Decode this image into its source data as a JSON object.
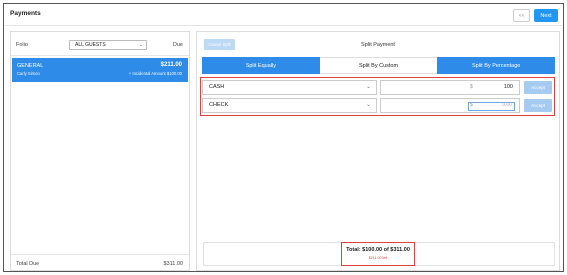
{
  "header": {
    "title": "Payments",
    "back_label": "<<",
    "next_label": "Next"
  },
  "folio_panel": {
    "folio_label": "Folio",
    "guest_filter": "ALL GUESTS",
    "due_label": "Due",
    "rows": [
      {
        "name": "GENERAL",
        "guest": "Carly Simon",
        "amount": "$211.00",
        "note": "+ Incidental Amount $100.00"
      }
    ],
    "total_due_label": "Total Due",
    "total_due_value": "$311.00"
  },
  "split_panel": {
    "cancel_label": "Cancel Split",
    "title": "Split Payment",
    "tabs": [
      "Split Equally",
      "Split By Custom",
      "Split By Percentage"
    ],
    "active_tab": "Split By Custom",
    "payments": [
      {
        "method": "CASH",
        "currency": "$",
        "amount": "100",
        "accept_label": "Accept"
      },
      {
        "method": "CHECK",
        "currency": "$",
        "placeholder": "0.00",
        "accept_label": "Accept"
      }
    ],
    "total_text": "Total: $100.00 of $311.00",
    "remaining_text": "$211.00 left"
  },
  "colors": {
    "accent": "#2e8be8",
    "highlight": "#e0413a"
  }
}
